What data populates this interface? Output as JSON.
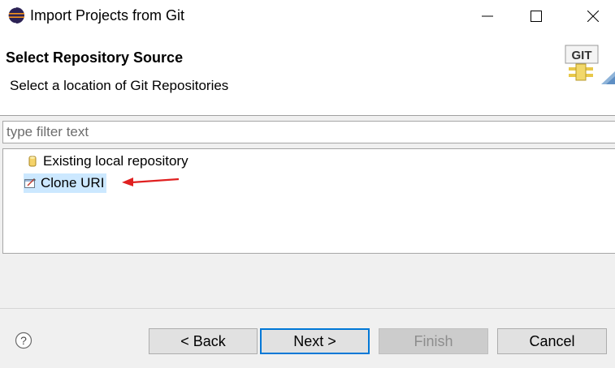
{
  "window": {
    "title": "Import Projects from Git",
    "app_icon": "eclipse-icon",
    "controls": [
      "minimize-icon",
      "maximize-icon",
      "close-icon"
    ]
  },
  "header": {
    "title": "Select Repository Source",
    "description": "Select a location of Git Repositories",
    "banner_icon": "git-banner-icon",
    "banner_text": "GIT"
  },
  "filter": {
    "value": "",
    "placeholder": "type filter text"
  },
  "tree": {
    "items": [
      {
        "label": "Existing local repository",
        "icon": "repository-icon",
        "selected": false
      },
      {
        "label": "Clone URI",
        "icon": "clone-uri-icon",
        "selected": true
      }
    ]
  },
  "annotation": {
    "icon": "red-arrow-icon",
    "color": "#e02020"
  },
  "footer": {
    "help_icon": "help-icon",
    "back_label": "< Back",
    "next_label": "Next >",
    "finish_label": "Finish",
    "cancel_label": "Cancel"
  },
  "colors": {
    "selection": "#cce8ff",
    "default_button_border": "#0078d7"
  }
}
